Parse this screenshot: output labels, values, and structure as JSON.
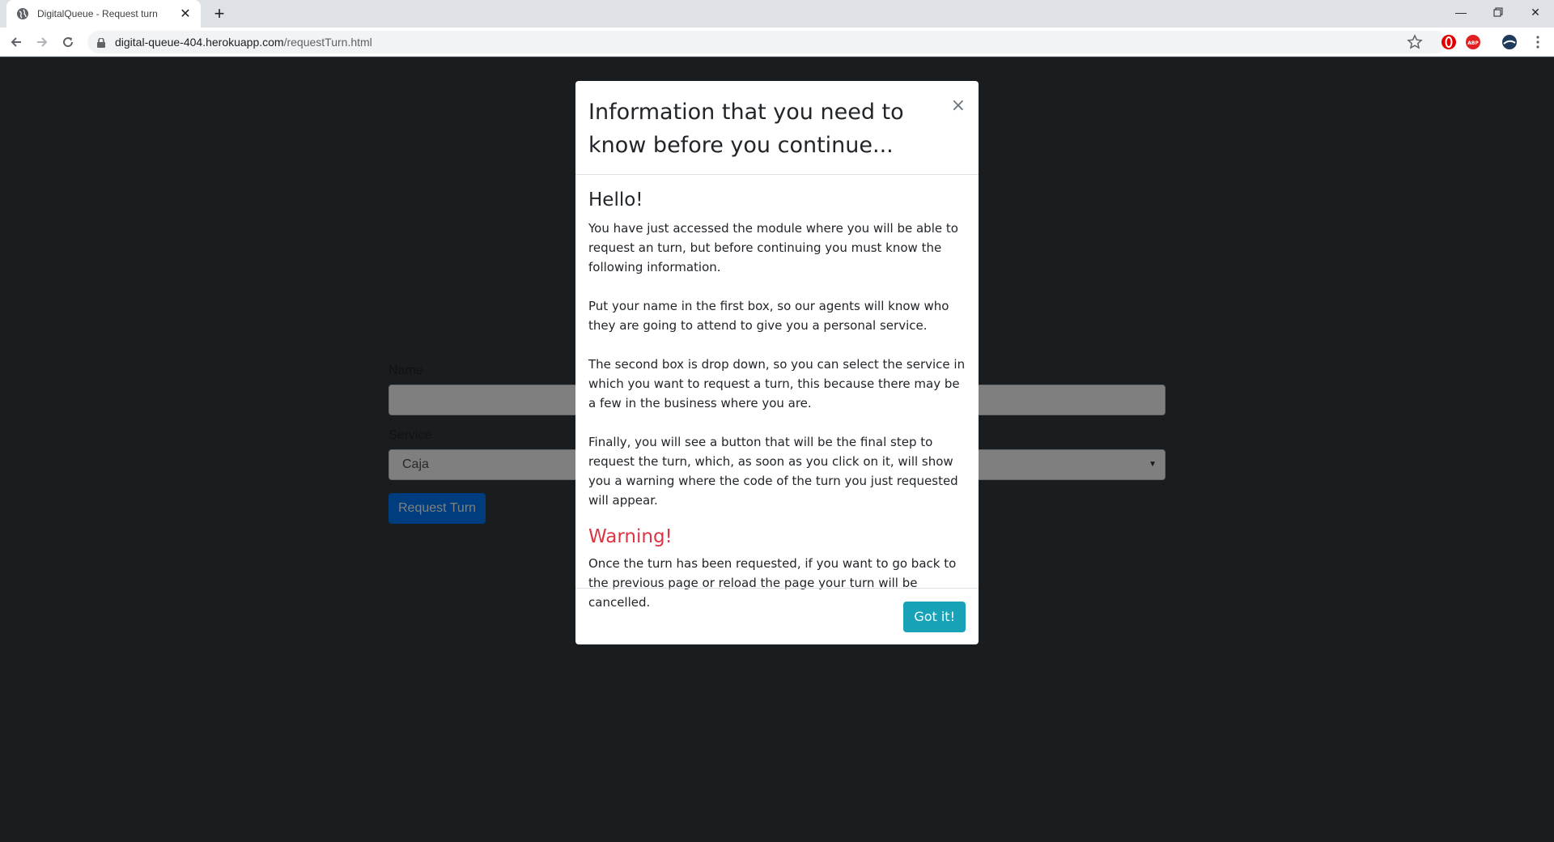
{
  "browser": {
    "tab_title": "DigitalQueue - Request turn",
    "url_host": "digital-queue-404.herokuapp.com",
    "url_path": "/requestTurn.html"
  },
  "page": {
    "name_label": "Name",
    "name_value": "",
    "service_label": "Service",
    "service_selected": "Caja",
    "submit_label": "Request Turn"
  },
  "modal": {
    "title": "Information that you need to know before you continue...",
    "close_symbol": "×",
    "hello_heading": "Hello!",
    "paragraphs": [
      "You have just accessed the module where you will be able to request an turn, but before continuing you must know the following information.",
      "Put your name in the first box, so our agents will know who they are going to attend to give you a personal service.",
      "The second box is drop down, so you can select the service in which you want to request a turn, this because there may be a few in the business where you are.",
      "Finally, you will see a button that will be the final step to request the turn, which, as soon as you click on it, will show you a warning where the code of the turn you just requested will appear."
    ],
    "warning_heading": "Warning!",
    "warning_text": "Once the turn has been requested, if you want to go back to the previous page or reload the page your turn will be cancelled.",
    "confirm_label": "Got it!"
  },
  "colors": {
    "page_bg": "#343a40",
    "primary": "#007bff",
    "info": "#17a2b8",
    "danger": "#dc3545"
  }
}
